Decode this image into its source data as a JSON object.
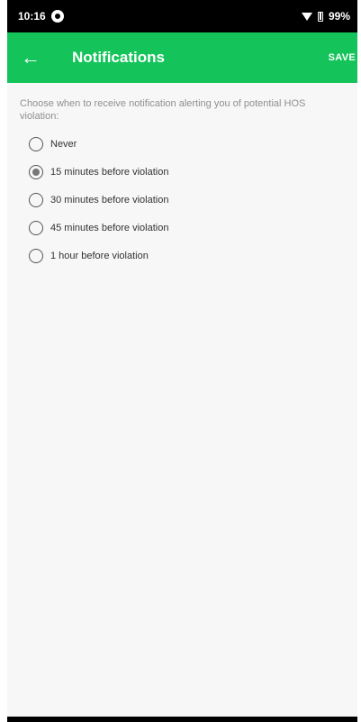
{
  "status_bar": {
    "time": "10:16",
    "battery": "99%",
    "icons": [
      "app-notification-icon",
      "wifi-icon",
      "battery-icon"
    ]
  },
  "app_bar": {
    "back_icon": "←",
    "title": "Notifications",
    "save_label": "SAVE",
    "color": "#14c45a"
  },
  "content": {
    "description": "Choose when to receive notification alerting you of potential HOS violation:",
    "options": [
      {
        "label": "Never",
        "checked": false
      },
      {
        "label": "15 minutes before violation",
        "checked": true
      },
      {
        "label": "30 minutes before violation",
        "checked": false
      },
      {
        "label": "45 minutes before violation",
        "checked": false
      },
      {
        "label": "1 hour before violation",
        "checked": false
      }
    ]
  }
}
